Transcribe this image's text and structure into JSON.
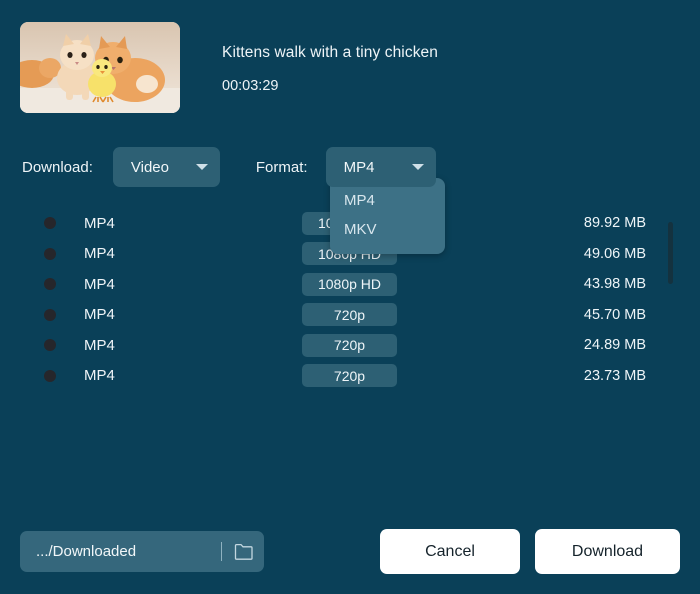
{
  "media": {
    "title": "Kittens walk with a tiny chicken",
    "duration": "00:03:29",
    "thumbnail_alt": "kittens-with-chick-thumbnail"
  },
  "controls": {
    "download_label": "Download:",
    "download_value": "Video",
    "format_label": "Format:",
    "format_value": "MP4",
    "format_options": [
      "MP4",
      "MKV"
    ]
  },
  "formats": [
    {
      "ext": "MP4",
      "quality": "1080p HD",
      "size": "89.92 MB"
    },
    {
      "ext": "MP4",
      "quality": "1080p HD",
      "size": "49.06 MB"
    },
    {
      "ext": "MP4",
      "quality": "1080p HD",
      "size": "43.98 MB"
    },
    {
      "ext": "MP4",
      "quality": "720p",
      "size": "45.70 MB"
    },
    {
      "ext": "MP4",
      "quality": "720p",
      "size": "24.89 MB"
    },
    {
      "ext": "MP4",
      "quality": "720p",
      "size": "23.73 MB"
    }
  ],
  "footer": {
    "path_value": ".../Downloaded",
    "folder_icon": "folder-icon",
    "cancel_label": "Cancel",
    "download_label": "Download"
  },
  "colors": {
    "background": "#0a4058",
    "control": "#2d6074",
    "menu": "#3d7186",
    "button": "#ffffff",
    "text": "#eef4f7"
  }
}
